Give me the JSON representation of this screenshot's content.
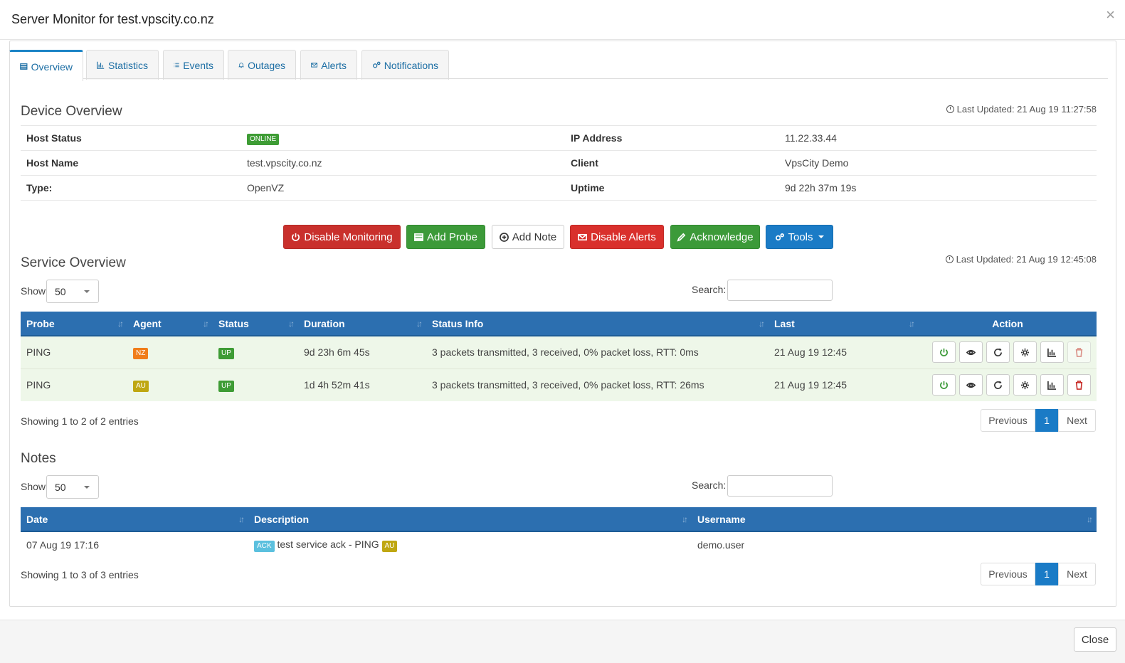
{
  "modal": {
    "title": "Server Monitor for test.vpscity.co.nz",
    "close_x": "×",
    "close_label": "Close"
  },
  "tabs": [
    {
      "label": "Overview",
      "icon": "server-icon",
      "active": true
    },
    {
      "label": "Statistics",
      "icon": "bar-chart-icon"
    },
    {
      "label": "Events",
      "icon": "list-icon"
    },
    {
      "label": "Outages",
      "icon": "bell-icon"
    },
    {
      "label": "Alerts",
      "icon": "envelope-icon"
    },
    {
      "label": "Notifications",
      "icon": "cogs-icon"
    }
  ],
  "device": {
    "title": "Device Overview",
    "last_updated": "Last Updated: 21 Aug 19 11:27:58",
    "rows": [
      {
        "label1": "Host Status",
        "value1": "ONLINE",
        "label2": "IP Address",
        "value2": "11.22.33.44"
      },
      {
        "label1": "Host Name",
        "value1": "test.vpscity.co.nz",
        "label2": "Client",
        "value2": "VpsCity Demo"
      },
      {
        "label1": "Type:",
        "value1": "OpenVZ",
        "label2": "Uptime",
        "value2": "9d 22h 37m 19s"
      }
    ]
  },
  "actions": {
    "disable_monitoring": "Disable Monitoring",
    "add_probe": "Add Probe",
    "add_note": "Add Note",
    "disable_alerts": "Disable Alerts",
    "acknowledge": "Acknowledge",
    "tools": "Tools"
  },
  "service": {
    "title": "Service Overview",
    "last_updated": "Last Updated: 21 Aug 19 12:45:08",
    "show_label": "Show",
    "page_size": "50",
    "search_label": "Search:",
    "columns": [
      "Probe",
      "Agent",
      "Status",
      "Duration",
      "Status Info",
      "Last",
      "Action"
    ],
    "rows": [
      {
        "probe": "PING",
        "agent": "NZ",
        "status": "UP",
        "duration": "9d 23h 6m 45s",
        "info": "3 packets transmitted, 3 received, 0% packet loss, RTT: 0ms",
        "last": "21 Aug 19 12:45"
      },
      {
        "probe": "PING",
        "agent": "AU",
        "status": "UP",
        "duration": "1d 4h 52m 41s",
        "info": "3 packets transmitted, 3 received, 0% packet loss, RTT: 26ms",
        "last": "21 Aug 19 12:45"
      }
    ],
    "showing": "Showing 1 to 2 of 2 entries",
    "pager": {
      "prev": "Previous",
      "page": "1",
      "next": "Next"
    }
  },
  "notes": {
    "title": "Notes",
    "show_label": "Show",
    "page_size": "50",
    "search_label": "Search:",
    "columns": [
      "Date",
      "Description",
      "Username"
    ],
    "rows": [
      {
        "date": "07 Aug 19 17:16",
        "tag": "ACK",
        "description": "test service ack - PING",
        "agent": "AU",
        "username": "demo.user"
      }
    ],
    "showing": "Showing 1 to 3 of 3 entries",
    "pager": {
      "prev": "Previous",
      "page": "1",
      "next": "Next"
    }
  },
  "colors": {
    "primary": "#1a7bc6",
    "header_bg": "#2c6fb0",
    "success": "#3c9a39",
    "danger": "#c9302c",
    "row_success": "#eef7e9",
    "badge_nz": "#f07d1a",
    "badge_au": "#bfa712",
    "badge_ack": "#5bc0de"
  }
}
